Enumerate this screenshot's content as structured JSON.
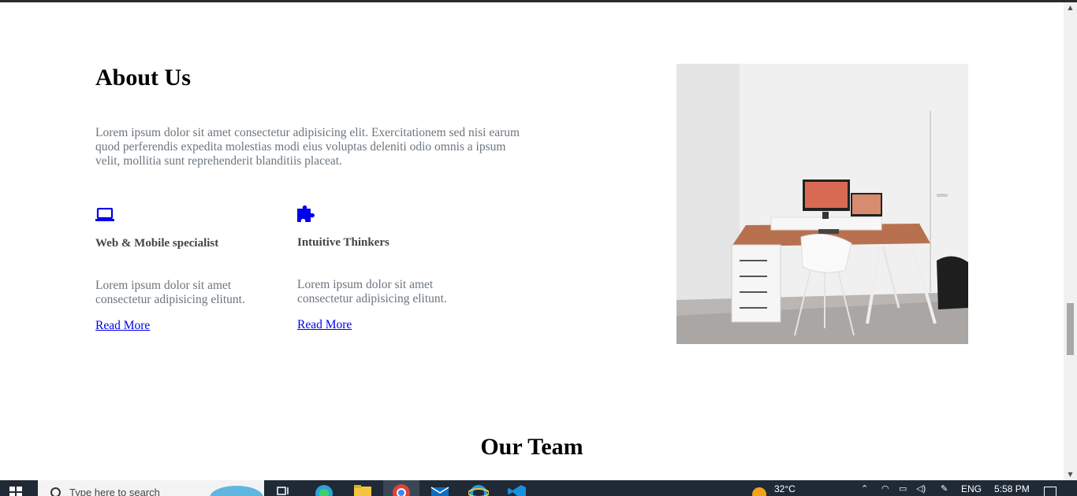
{
  "about": {
    "title": "About Us",
    "text": "Lorem ipsum dolor sit amet consectetur adipisicing elit. Exercitationem sed nisi earum quod perferendis expedita molestias modi eius voluptas deleniti odio omnis a ipsum velit, mollitia sunt reprehenderit blanditiis placeat.",
    "features": [
      {
        "icon": "laptop-icon",
        "title": "Web & Mobile specialist",
        "text": "Lorem ipsum dolor sit amet consectetur adipisicing elitunt.",
        "link": "Read More"
      },
      {
        "icon": "puzzle-icon",
        "title": "Intuitive Thinkers",
        "text": "Lorem ipsum dolor sit amet consectetur adipisicing elitunt.",
        "link": "Read More"
      }
    ],
    "photo_alt": "Workspace desk with monitors"
  },
  "team": {
    "title": "Our Team"
  },
  "colors": {
    "accent": "#0000ee",
    "text_muted": "#6c757d",
    "taskbar": "#1f2a36"
  },
  "taskbar": {
    "search_placeholder": "Type here to search",
    "weather": "32°C",
    "language": "ENG",
    "time": "5:58 PM",
    "apps": [
      "task-view-icon",
      "edge-icon",
      "file-explorer-icon",
      "chrome-icon",
      "mail-icon",
      "internet-explorer-icon",
      "vscode-icon"
    ]
  }
}
